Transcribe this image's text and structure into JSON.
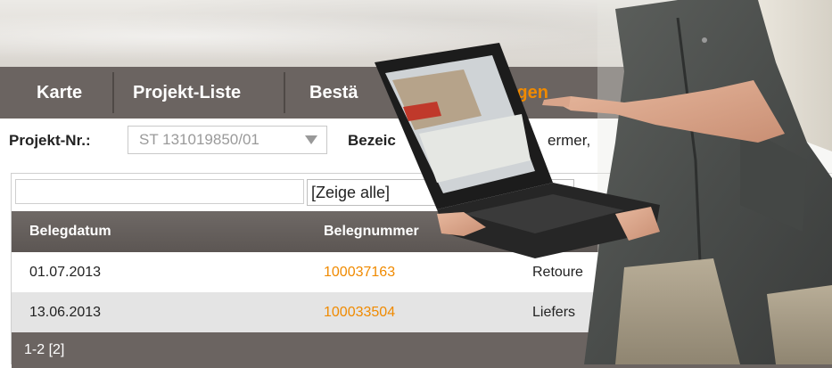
{
  "nav": {
    "items": [
      {
        "label": "Karte"
      },
      {
        "label": "Projekt-Liste"
      },
      {
        "label": "Bestä"
      },
      {
        "label": "ungen"
      }
    ]
  },
  "filter": {
    "project_label": "Projekt-Nr.:",
    "project_value": "ST 131019850/01",
    "bez_label": "Bezeic",
    "bez_value": "ermer,"
  },
  "table": {
    "filter_select": "[Zeige alle]",
    "columns": [
      "Belegdatum",
      "Belegnummer"
    ],
    "rows": [
      {
        "date": "01.07.2013",
        "number": "100037163",
        "type": "Retoure"
      },
      {
        "date": "13.06.2013",
        "number": "100033504",
        "type": "Liefers"
      }
    ],
    "pager": "1-2 [2]"
  },
  "colors": {
    "nav_bg": "#6b6461",
    "accent": "#f08a00",
    "row_alt": "#e4e4e4"
  }
}
